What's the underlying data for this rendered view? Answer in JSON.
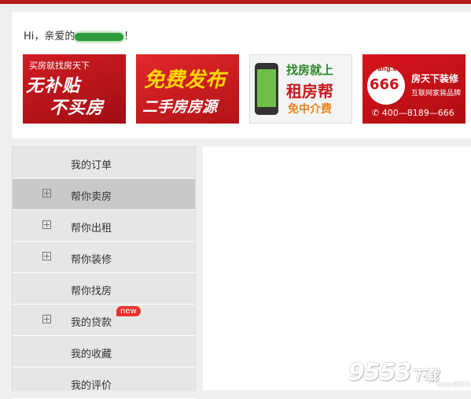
{
  "greeting": {
    "prefix": "Hi，亲爱的",
    "suffix": "！"
  },
  "banners": [
    {
      "small": "买房就找房天下",
      "line1": "无补贴",
      "line2": "不买房"
    },
    {
      "line1": "免费发布",
      "line2": "二手房房源"
    },
    {
      "line1": "找房就上",
      "line2": "租房帮",
      "line3": "免中介费"
    },
    {
      "logo": "Fang.com",
      "number": "666",
      "title": "房天下装修",
      "subtitle": "互联网家装品牌",
      "phone": "400—8189—666"
    }
  ],
  "sidebar": {
    "items": [
      {
        "label": "我的订单",
        "expandable": false
      },
      {
        "label": "帮你卖房",
        "expandable": true,
        "active": true
      },
      {
        "label": "帮你出租",
        "expandable": true
      },
      {
        "label": "帮你装修",
        "expandable": true
      },
      {
        "label": "帮你找房",
        "expandable": false
      },
      {
        "label": "我的贷款",
        "expandable": true,
        "badge": "new"
      },
      {
        "label": "我的收藏",
        "expandable": false
      },
      {
        "label": "我的评价",
        "expandable": false
      }
    ]
  },
  "watermark": {
    "text": "9553",
    "sub": "下载",
    "url": "www.9553.com"
  },
  "colors": {
    "brand_red": "#b4191a",
    "badge": "#e8322d"
  }
}
